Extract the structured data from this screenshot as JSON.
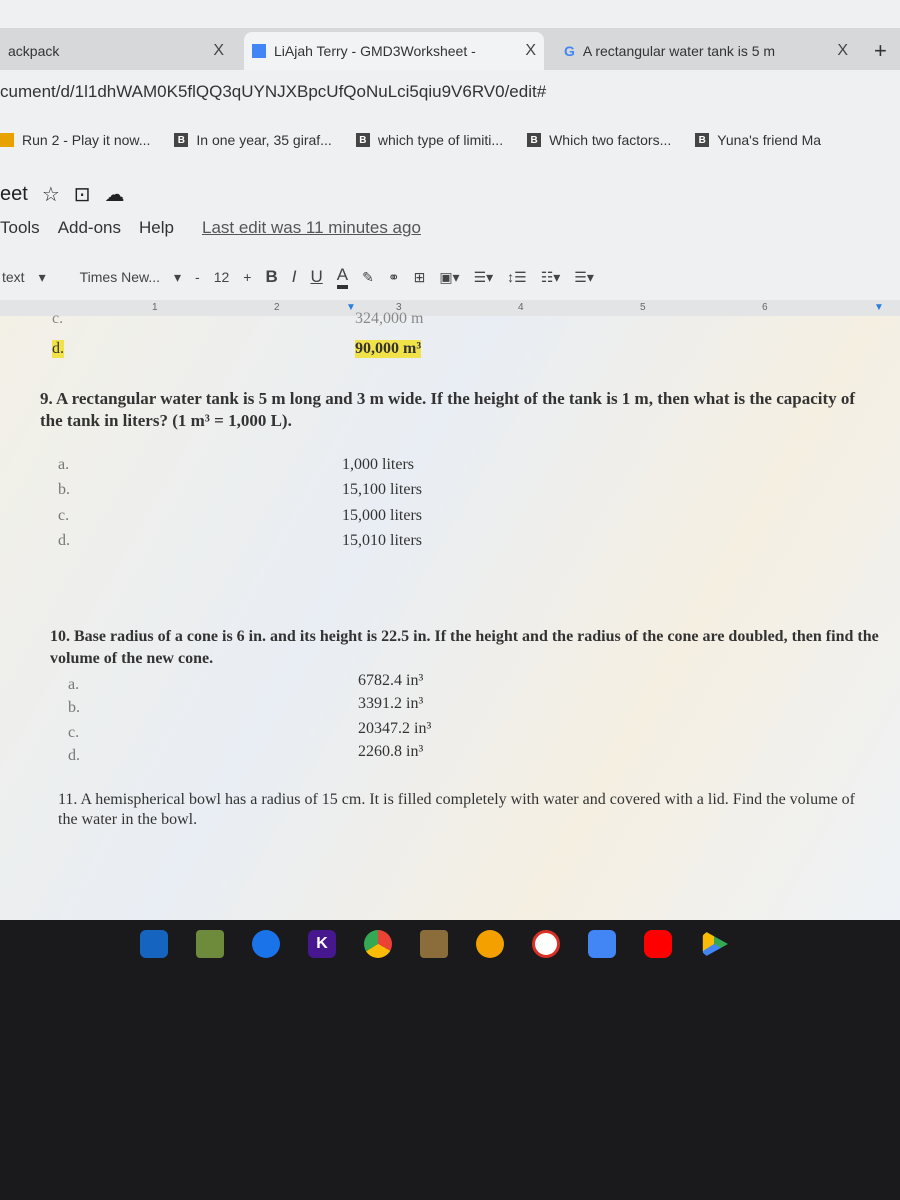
{
  "browser": {
    "tabs": [
      {
        "label": "ackpack"
      },
      {
        "label": "LiAjah Terry - GMD3Worksheet -"
      },
      {
        "label": "A rectangular water tank is 5 m"
      }
    ],
    "close_label": "X",
    "new_tab": "+",
    "url": "cument/d/1l1dhWAM0K5flQQ3qUYNJXBpcUfQoNuLci5qiu9V6RV0/edit#",
    "bookmarks": [
      {
        "label": "Run 2 - Play it now..."
      },
      {
        "label": "In one year, 35 giraf..."
      },
      {
        "label": "which type of limiti..."
      },
      {
        "label": "Which two factors..."
      },
      {
        "label": "Yuna's friend Ma"
      }
    ],
    "bookmark_badge": "B"
  },
  "docs": {
    "title": "eet",
    "menu": [
      "Tools",
      "Add-ons",
      "Help"
    ],
    "last_edit": "Last edit was 11 minutes ago",
    "toolbar": {
      "style": "text",
      "font": "Times New...",
      "minus": "-",
      "size": "12",
      "plus": "+",
      "bold": "B",
      "italic": "I",
      "underline": "U",
      "color": "A"
    },
    "ruler": [
      "1",
      "2",
      "3",
      "4",
      "5",
      "6"
    ]
  },
  "document": {
    "prev": {
      "c_label": "c.",
      "c_value": "324,000 m",
      "d_label": "d.",
      "d_value": "90,000 m³"
    },
    "q9": {
      "text": "9. A rectangular water tank is 5 m long and 3 m wide. If the height of the tank is 1 m, then what is the capacity of the tank in liters? (1 m³ = 1,000 L).",
      "options": [
        {
          "label": "a.",
          "value": "1,000 liters"
        },
        {
          "label": "b.",
          "value": "15,100 liters"
        },
        {
          "label": "c.",
          "value": "15,000 liters"
        },
        {
          "label": "d.",
          "value": "15,010 liters"
        }
      ]
    },
    "q10": {
      "text": "10. Base radius of a cone is 6 in. and its height is 22.5 in. If the height and the radius of the cone are doubled, then find the volume of the new cone.",
      "options": [
        {
          "label": "a.",
          "value": "6782.4 in³"
        },
        {
          "label": "b.",
          "value": "3391.2 in³"
        },
        {
          "label": "c.",
          "value": "20347.2 in³"
        },
        {
          "label": "d.",
          "value": "2260.8 in³"
        }
      ]
    },
    "q11": {
      "text": "11. A hemispherical bowl has a radius of 15 cm. It is filled completely with water and covered with a lid. Find the volume of the water in the bowl."
    }
  },
  "shelf": {
    "apps": [
      "camera",
      "minecraft",
      "duo",
      "kahoot",
      "chrome",
      "files",
      "scratch",
      "gmail",
      "docs",
      "youtube",
      "play-store"
    ],
    "kahoot_letter": "K"
  }
}
